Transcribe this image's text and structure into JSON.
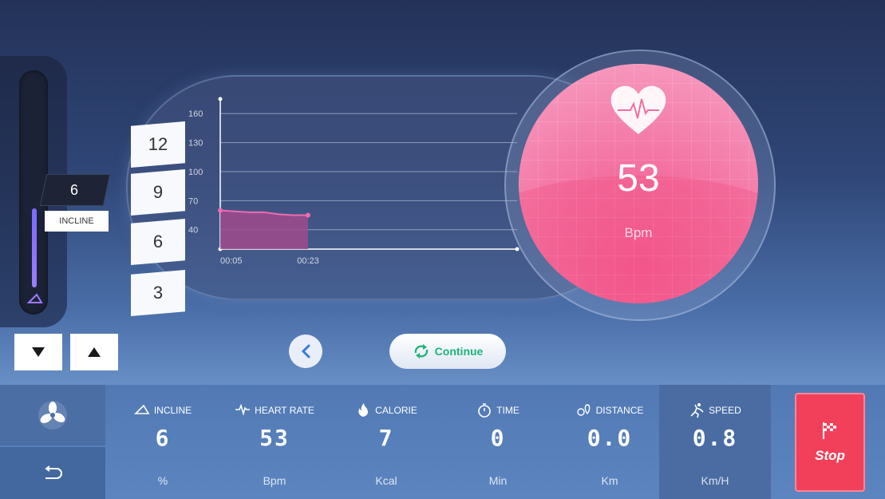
{
  "incline_control": {
    "current_value": "6",
    "label": "INCLINE",
    "level_fraction": 0.38
  },
  "levels": [
    "12",
    "9",
    "6",
    "3"
  ],
  "chart_data": {
    "type": "area",
    "title": "",
    "xlabel": "",
    "ylabel": "",
    "y_ticks": [
      "160",
      "130",
      "100",
      "70",
      "40"
    ],
    "x_ticks": [
      "00:05",
      "00:23"
    ],
    "ylim": [
      20,
      175
    ],
    "x": [
      "00:05",
      "00:08",
      "00:11",
      "00:14",
      "00:17",
      "00:20",
      "00:23"
    ],
    "series": [
      {
        "values": [
          60,
          59,
          58,
          58,
          56,
          55,
          55
        ]
      }
    ],
    "grid": true,
    "colors": {
      "fill": "#a04a8c",
      "line": "#f06bb0"
    }
  },
  "heart_rate": {
    "value": "53",
    "unit": "Bpm"
  },
  "nav": {
    "continue_label": "Continue"
  },
  "stats": [
    {
      "key": "incline",
      "label": "INCLINE",
      "value": "6",
      "unit": "%",
      "icon": "incline-icon"
    },
    {
      "key": "heart",
      "label": "HEART RATE",
      "value": "53",
      "unit": "Bpm",
      "icon": "heart-rate-icon"
    },
    {
      "key": "calorie",
      "label": "CALORIE",
      "value": "7",
      "unit": "Kcal",
      "icon": "flame-icon"
    },
    {
      "key": "time",
      "label": "TIME",
      "value": "0",
      "unit": "Min",
      "icon": "stopwatch-icon"
    },
    {
      "key": "distance",
      "label": "DISTANCE",
      "value": "0.0",
      "unit": "Km",
      "icon": "location-pin-icon"
    },
    {
      "key": "speed",
      "label": "SPEED",
      "value": "0.8",
      "unit": "Km/H",
      "icon": "runner-icon"
    }
  ],
  "stop_label": "Stop",
  "colors": {
    "stop": "#f2405b",
    "continue_text": "#1eb37a",
    "slider_fill": "#8a74ff",
    "heart_circle": "#f36fa0"
  }
}
